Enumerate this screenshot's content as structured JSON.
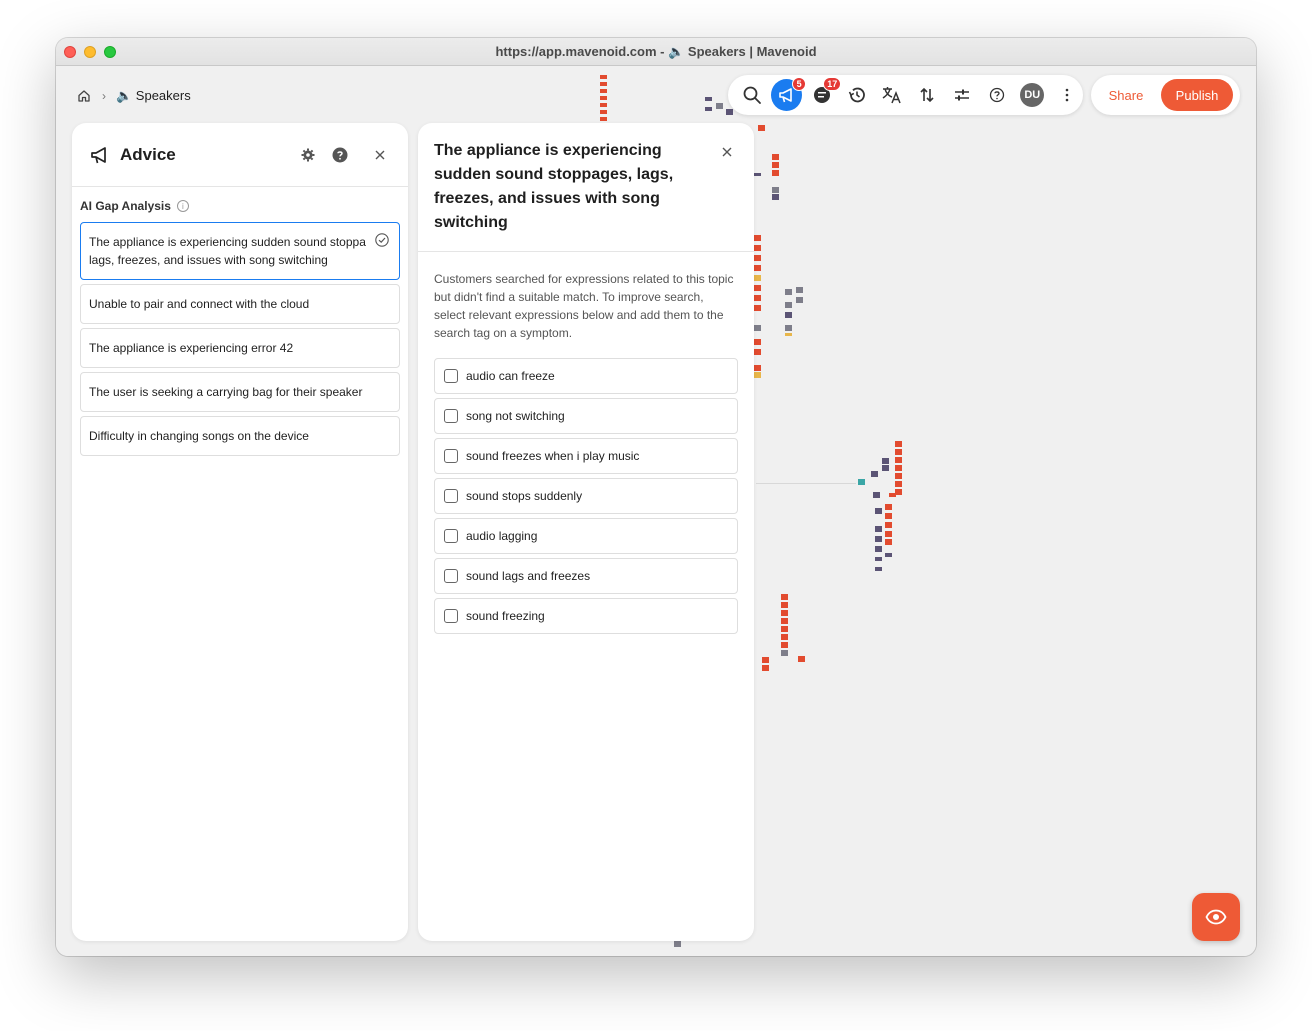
{
  "window": {
    "title": "https://app.mavenoid.com - 🔈 Speakers | Mavenoid"
  },
  "breadcrumb": {
    "current": "🔈 Speakers"
  },
  "toolbar": {
    "advice_badge": "5",
    "comments_badge": "17",
    "avatar_initials": "DU"
  },
  "actions": {
    "share_label": "Share",
    "publish_label": "Publish"
  },
  "advice_panel": {
    "title": "Advice",
    "section_label": "AI Gap Analysis",
    "topics": [
      "The appliance is experiencing sudden sound stoppa lags, freezes, and issues with song switching",
      "Unable to pair and connect with the cloud",
      "The appliance is experiencing error 42",
      "The user is seeking a carrying bag for their speaker",
      "Difficulty in changing songs on the device"
    ]
  },
  "detail_panel": {
    "title": "The appliance is experiencing sudden sound stoppages, lags, freezes, and issues with song switching",
    "description": "Customers searched for expressions related to this topic but didn't find a suitable match. To improve search, select relevant expressions below and add them to the search tag on a symptom.",
    "expressions": [
      "audio can freeze",
      "song not switching",
      "sound freezes when i play music",
      "sound stops suddenly",
      "audio lagging",
      "sound lags and freezes",
      "sound freezing"
    ]
  },
  "colors": {
    "accent": "#ee5a36",
    "active": "#1a7cf0",
    "badge": "#e53935"
  }
}
